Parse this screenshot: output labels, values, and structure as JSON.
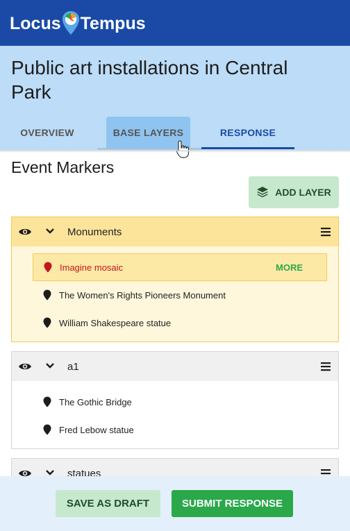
{
  "brand": {
    "left": "Locus",
    "right": "Tempus"
  },
  "page": {
    "title": "Public art installations in Central Park"
  },
  "tabs": [
    {
      "label": "OVERVIEW"
    },
    {
      "label": "BASE LAYERS"
    },
    {
      "label": "RESPONSE"
    }
  ],
  "section": {
    "title": "Event Markers",
    "add_layer_label": "ADD LAYER"
  },
  "layers": [
    {
      "name": "Monuments",
      "items": [
        {
          "label": "Imagine mosaic",
          "more": "MORE"
        },
        {
          "label": "The Women's Rights Pioneers Monument"
        },
        {
          "label": "William Shakespeare statue"
        }
      ]
    },
    {
      "name": "a1",
      "items": [
        {
          "label": "The Gothic Bridge"
        },
        {
          "label": "Fred Lebow statue"
        }
      ]
    },
    {
      "name": "statues",
      "items": []
    }
  ],
  "actions": {
    "draft_label": "SAVE AS DRAFT",
    "submit_label": "SUBMIT RESPONSE"
  },
  "colors": {
    "brand": "#1a4aa6",
    "accent": "#2aa84a",
    "highlight": "#fde49b",
    "marker_selected": "#c4161c"
  },
  "icons": [
    "logo-pin-icon",
    "cursor-hand-icon",
    "layers-icon",
    "eye-icon",
    "chevron-down-icon",
    "menu-icon",
    "map-marker-icon"
  ]
}
